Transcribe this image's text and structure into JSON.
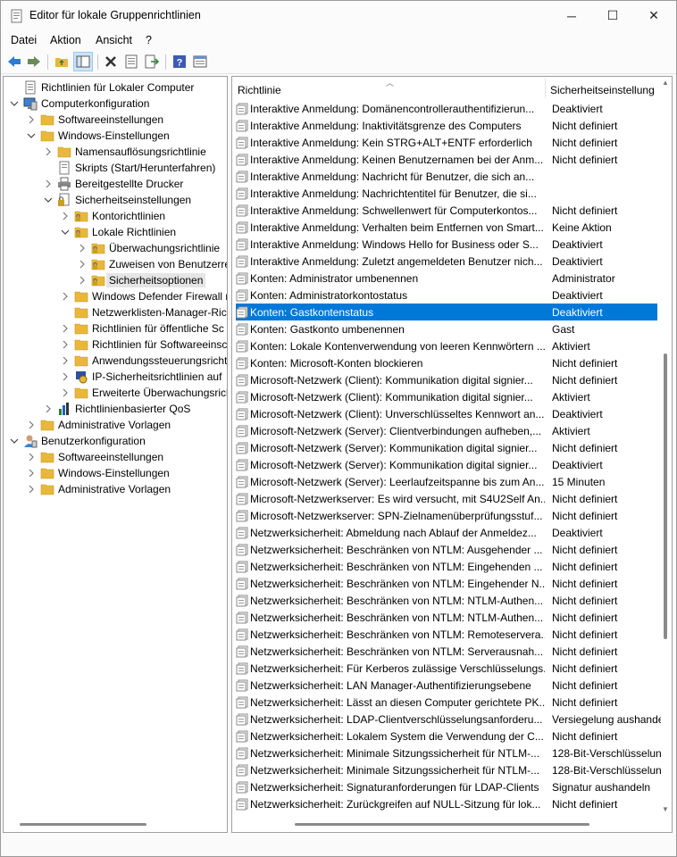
{
  "window": {
    "title": "Editor für lokale Gruppenrichtlinien",
    "minimize": "─",
    "maximize": "☐",
    "close": "✕"
  },
  "menu": [
    "Datei",
    "Aktion",
    "Ansicht",
    "?"
  ],
  "tree": [
    {
      "label": "Richtlinien für Lokaler Computer",
      "level": 0,
      "exp": "",
      "icon": "computer-policy-icon"
    },
    {
      "label": "Computerkonfiguration",
      "level": 0,
      "exp": "open",
      "icon": "computer-icon"
    },
    {
      "label": "Softwareeinstellungen",
      "level": 1,
      "exp": "closed",
      "icon": "folder-icon"
    },
    {
      "label": "Windows-Einstellungen",
      "level": 1,
      "exp": "open",
      "icon": "folder-icon"
    },
    {
      "label": "Namensauflösungsrichtlinie",
      "level": 2,
      "exp": "closed",
      "icon": "folder-icon"
    },
    {
      "label": "Skripts (Start/Herunterfahren)",
      "level": 2,
      "exp": "",
      "icon": "script-icon"
    },
    {
      "label": "Bereitgestellte Drucker",
      "level": 2,
      "exp": "closed",
      "icon": "printer-icon"
    },
    {
      "label": "Sicherheitseinstellungen",
      "level": 2,
      "exp": "open",
      "icon": "security-settings-icon"
    },
    {
      "label": "Kontorichtlinien",
      "level": 3,
      "exp": "closed",
      "icon": "locked-folder-icon"
    },
    {
      "label": "Lokale Richtlinien",
      "level": 3,
      "exp": "open",
      "icon": "locked-folder-icon"
    },
    {
      "label": "Überwachungsrichtlinie",
      "level": 4,
      "exp": "closed",
      "icon": "locked-folder-icon"
    },
    {
      "label": "Zuweisen von Benutzerre",
      "level": 4,
      "exp": "closed",
      "icon": "locked-folder-icon"
    },
    {
      "label": "Sicherheitsoptionen",
      "level": 4,
      "exp": "closed",
      "icon": "locked-folder-icon",
      "selected": true
    },
    {
      "label": "Windows Defender Firewall n",
      "level": 3,
      "exp": "closed",
      "icon": "folder-icon"
    },
    {
      "label": "Netzwerklisten-Manager-Ric",
      "level": 3,
      "exp": "",
      "icon": "folder-icon"
    },
    {
      "label": "Richtlinien für öffentliche Sc",
      "level": 3,
      "exp": "closed",
      "icon": "folder-icon"
    },
    {
      "label": "Richtlinien für Softwareeinsc",
      "level": 3,
      "exp": "closed",
      "icon": "folder-icon"
    },
    {
      "label": "Anwendungssteuerungsricht",
      "level": 3,
      "exp": "closed",
      "icon": "folder-icon"
    },
    {
      "label": "IP-Sicherheitsrichtlinien auf",
      "level": 3,
      "exp": "closed",
      "icon": "ip-security-icon"
    },
    {
      "label": "Erweiterte Überwachungsricl",
      "level": 3,
      "exp": "closed",
      "icon": "folder-icon"
    },
    {
      "label": "Richtlinienbasierter QoS",
      "level": 2,
      "exp": "closed",
      "icon": "qos-chart-icon"
    },
    {
      "label": "Administrative Vorlagen",
      "level": 1,
      "exp": "closed",
      "icon": "folder-icon"
    },
    {
      "label": "Benutzerkonfiguration",
      "level": 0,
      "exp": "open",
      "icon": "user-icon"
    },
    {
      "label": "Softwareeinstellungen",
      "level": 1,
      "exp": "closed",
      "icon": "folder-icon"
    },
    {
      "label": "Windows-Einstellungen",
      "level": 1,
      "exp": "closed",
      "icon": "folder-icon"
    },
    {
      "label": "Administrative Vorlagen",
      "level": 1,
      "exp": "closed",
      "icon": "folder-icon"
    }
  ],
  "list": {
    "col_policy": "Richtlinie",
    "col_setting": "Sicherheitseinstellung",
    "rows": [
      {
        "policy": "Interaktive Anmeldung: Domänencontrollerauthentifizierun...",
        "setting": "Deaktiviert"
      },
      {
        "policy": "Interaktive Anmeldung: Inaktivitätsgrenze des Computers",
        "setting": "Nicht definiert"
      },
      {
        "policy": "Interaktive Anmeldung: Kein STRG+ALT+ENTF erforderlich",
        "setting": "Nicht definiert"
      },
      {
        "policy": "Interaktive Anmeldung: Keinen Benutzernamen bei der Anm...",
        "setting": "Nicht definiert"
      },
      {
        "policy": "Interaktive Anmeldung: Nachricht für Benutzer, die sich an...",
        "setting": ""
      },
      {
        "policy": "Interaktive Anmeldung: Nachrichtentitel für Benutzer, die si...",
        "setting": ""
      },
      {
        "policy": "Interaktive Anmeldung: Schwellenwert für Computerkontos...",
        "setting": "Nicht definiert"
      },
      {
        "policy": "Interaktive Anmeldung: Verhalten beim Entfernen von Smart...",
        "setting": "Keine Aktion"
      },
      {
        "policy": "Interaktive Anmeldung: Windows Hello for Business oder S...",
        "setting": "Deaktiviert"
      },
      {
        "policy": "Interaktive Anmeldung: Zuletzt angemeldeten Benutzer nich...",
        "setting": "Deaktiviert"
      },
      {
        "policy": "Konten: Administrator umbenennen",
        "setting": "Administrator"
      },
      {
        "policy": "Konten: Administratorkontostatus",
        "setting": "Deaktiviert"
      },
      {
        "policy": "Konten: Gastkontenstatus",
        "setting": "Deaktiviert",
        "selected": true
      },
      {
        "policy": "Konten: Gastkonto umbenennen",
        "setting": "Gast"
      },
      {
        "policy": "Konten: Lokale Kontenverwendung von leeren Kennwörtern ...",
        "setting": "Aktiviert"
      },
      {
        "policy": "Konten: Microsoft-Konten blockieren",
        "setting": "Nicht definiert"
      },
      {
        "policy": "Microsoft-Netzwerk (Client): Kommunikation digital signier...",
        "setting": "Nicht definiert"
      },
      {
        "policy": "Microsoft-Netzwerk (Client): Kommunikation digital signier...",
        "setting": "Aktiviert"
      },
      {
        "policy": "Microsoft-Netzwerk (Client): Unverschlüsseltes Kennwort an...",
        "setting": "Deaktiviert"
      },
      {
        "policy": "Microsoft-Netzwerk (Server): Clientverbindungen aufheben,...",
        "setting": "Aktiviert"
      },
      {
        "policy": "Microsoft-Netzwerk (Server): Kommunikation digital signier...",
        "setting": "Nicht definiert"
      },
      {
        "policy": "Microsoft-Netzwerk (Server): Kommunikation digital signier...",
        "setting": "Deaktiviert"
      },
      {
        "policy": "Microsoft-Netzwerk (Server): Leerlaufzeitspanne bis zum An...",
        "setting": "15 Minuten"
      },
      {
        "policy": "Microsoft-Netzwerkserver: Es wird versucht, mit S4U2Self An...",
        "setting": "Nicht definiert"
      },
      {
        "policy": "Microsoft-Netzwerkserver: SPN-Zielnamenüberprüfungsstuf...",
        "setting": "Nicht definiert"
      },
      {
        "policy": "Netzwerksicherheit: Abmeldung nach Ablauf der Anmeldez...",
        "setting": "Deaktiviert"
      },
      {
        "policy": "Netzwerksicherheit: Beschränken von NTLM: Ausgehender ...",
        "setting": "Nicht definiert"
      },
      {
        "policy": "Netzwerksicherheit: Beschränken von NTLM: Eingehenden ...",
        "setting": "Nicht definiert"
      },
      {
        "policy": "Netzwerksicherheit: Beschränken von NTLM: Eingehender N...",
        "setting": "Nicht definiert"
      },
      {
        "policy": "Netzwerksicherheit: Beschränken von NTLM: NTLM-Authen...",
        "setting": "Nicht definiert"
      },
      {
        "policy": "Netzwerksicherheit: Beschränken von NTLM: NTLM-Authen...",
        "setting": "Nicht definiert"
      },
      {
        "policy": "Netzwerksicherheit: Beschränken von NTLM: Remoteservera...",
        "setting": "Nicht definiert"
      },
      {
        "policy": "Netzwerksicherheit: Beschränken von NTLM: Serverausnah...",
        "setting": "Nicht definiert"
      },
      {
        "policy": "Netzwerksicherheit: Für Kerberos zulässige Verschlüsselungs...",
        "setting": "Nicht definiert"
      },
      {
        "policy": "Netzwerksicherheit: LAN Manager-Authentifizierungsebene",
        "setting": "Nicht definiert"
      },
      {
        "policy": "Netzwerksicherheit: Lässt an diesen Computer gerichtete PK...",
        "setting": "Nicht definiert"
      },
      {
        "policy": "Netzwerksicherheit: LDAP-Clientverschlüsselungsanforderu...",
        "setting": "Versiegelung aushande"
      },
      {
        "policy": "Netzwerksicherheit: Lokalem System die Verwendung der C...",
        "setting": "Nicht definiert"
      },
      {
        "policy": "Netzwerksicherheit: Minimale Sitzungssicherheit für NTLM-...",
        "setting": "128-Bit-Verschlüsselun"
      },
      {
        "policy": "Netzwerksicherheit: Minimale Sitzungssicherheit für NTLM-...",
        "setting": "128-Bit-Verschlüsselun"
      },
      {
        "policy": "Netzwerksicherheit: Signaturanforderungen für LDAP-Clients",
        "setting": "Signatur aushandeln"
      },
      {
        "policy": "Netzwerksicherheit: Zurückgreifen auf NULL-Sitzung für lok...",
        "setting": "Nicht definiert"
      }
    ]
  },
  "colors": {
    "selection": "#0078d7",
    "tree_selection": "#e5e5e5",
    "folder": "#e8b73c",
    "toolbar_blue": "#2b7bd6"
  }
}
